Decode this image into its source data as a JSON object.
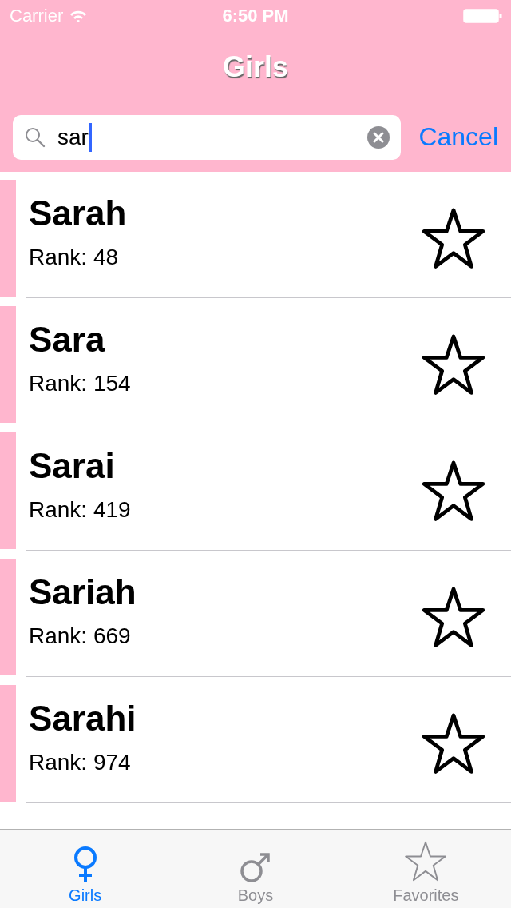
{
  "status_bar": {
    "carrier": "Carrier",
    "time": "6:50 PM"
  },
  "nav": {
    "title": "Girls"
  },
  "search": {
    "value": "sar",
    "cancel": "Cancel"
  },
  "names": [
    {
      "name": "Sarah",
      "rank": "Rank: 48",
      "favorite": false
    },
    {
      "name": "Sara",
      "rank": "Rank: 154",
      "favorite": false
    },
    {
      "name": "Sarai",
      "rank": "Rank: 419",
      "favorite": false
    },
    {
      "name": "Sariah",
      "rank": "Rank: 669",
      "favorite": false
    },
    {
      "name": "Sarahi",
      "rank": "Rank: 974",
      "favorite": false
    }
  ],
  "tabs": [
    {
      "label": "Girls",
      "kind": "female",
      "selected": true
    },
    {
      "label": "Boys",
      "kind": "male",
      "selected": false
    },
    {
      "label": "Favorites",
      "kind": "star",
      "selected": false
    }
  ]
}
